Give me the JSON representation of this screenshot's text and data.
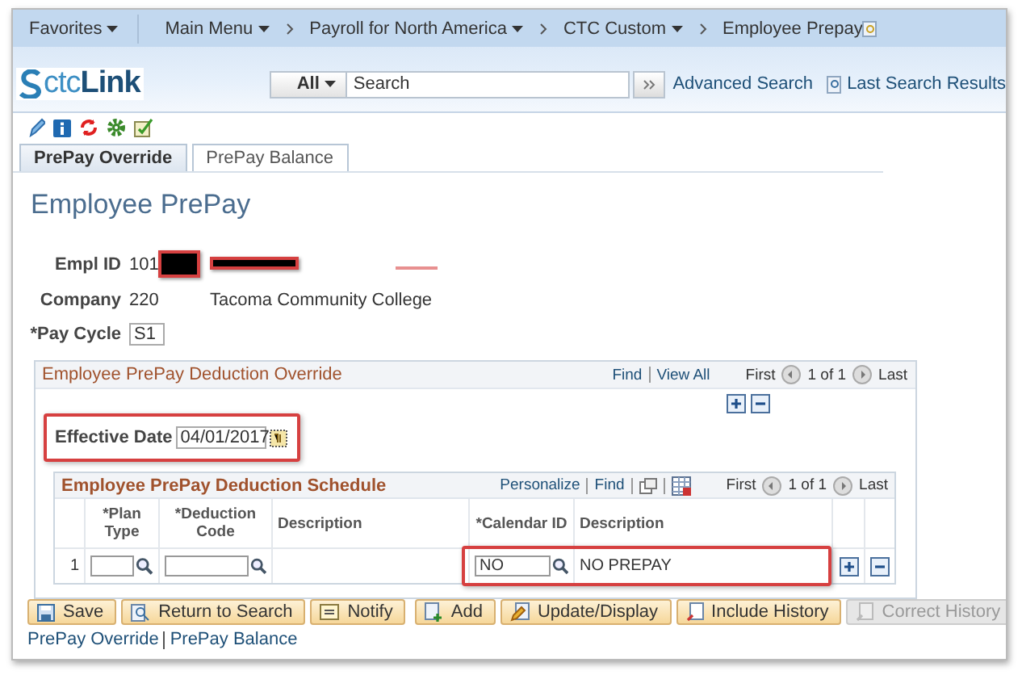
{
  "nav": {
    "items": [
      {
        "label": "Favorites",
        "dropdown": true
      },
      {
        "label": "Main Menu",
        "dropdown": true
      }
    ],
    "breadcrumbs": [
      {
        "label": "Payroll for North America",
        "dropdown": true
      },
      {
        "label": "CTC Custom",
        "dropdown": true
      },
      {
        "label": "Employee Prepay",
        "dropdown": false
      }
    ]
  },
  "logo": {
    "parts": [
      "ctc",
      "Link"
    ]
  },
  "search": {
    "scope": "All",
    "placeholder": "Search",
    "advanced_link": "Advanced Search",
    "last_results_link": "Last Search Results"
  },
  "tabs": [
    {
      "label": "PrePay Override",
      "selected": true
    },
    {
      "label": "PrePay Balance",
      "selected": false
    }
  ],
  "page_title": "Employee PrePay",
  "employee": {
    "empl_id_label": "Empl ID",
    "empl_id": "101",
    "company_label": "Company",
    "company": "220",
    "company_name": "Tacoma Community College",
    "pay_cycle_label": "*Pay Cycle",
    "pay_cycle": "S1"
  },
  "override": {
    "title": "Employee PrePay Deduction Override",
    "find": "Find",
    "view_all": "View All",
    "first": "First",
    "count": "1 of 1",
    "last": "Last",
    "effective_date_label": "Effective Date",
    "effective_date": "04/01/2017"
  },
  "schedule": {
    "title": "Employee PrePay Deduction Schedule",
    "personalize": "Personalize",
    "find": "Find",
    "first": "First",
    "count": "1 of 1",
    "last": "Last",
    "columns": [
      "*Plan Type",
      "*Deduction Code",
      "Description",
      "*Calendar ID",
      "Description"
    ],
    "rows": [
      {
        "number": "1",
        "calendar_id": "NO",
        "calendar_description": "NO PREPAY"
      }
    ]
  },
  "buttons": [
    {
      "label": "Save",
      "kind": "save",
      "disabled": false
    },
    {
      "label": "Return to Search",
      "kind": "return",
      "disabled": false
    },
    {
      "label": "Notify",
      "kind": "notify",
      "disabled": false
    },
    {
      "label": "Add",
      "kind": "add",
      "disabled": false
    },
    {
      "label": "Update/Display",
      "kind": "update",
      "disabled": false
    },
    {
      "label": "Include History",
      "kind": "history",
      "disabled": false
    },
    {
      "label": "Correct History",
      "kind": "correct",
      "disabled": true
    }
  ],
  "footer_links": [
    "PrePay Override",
    "PrePay Balance"
  ]
}
